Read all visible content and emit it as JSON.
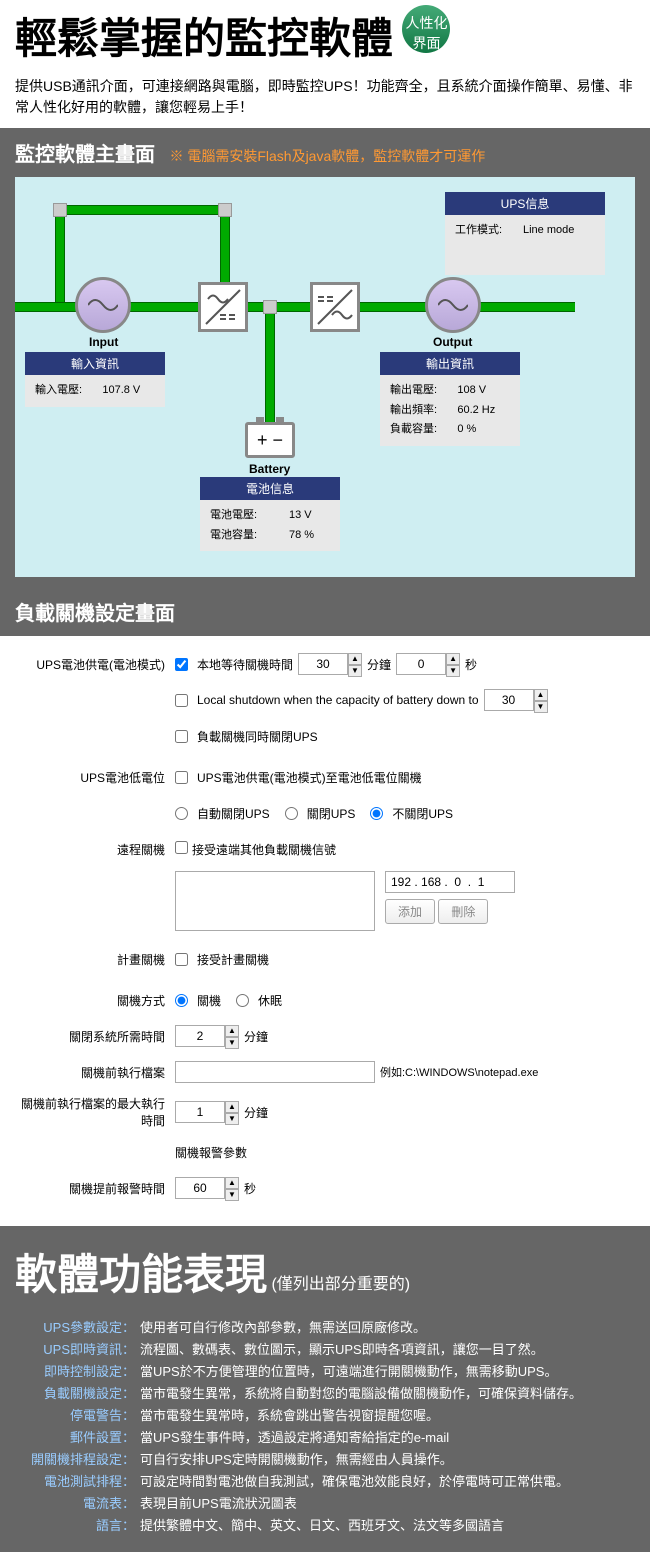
{
  "header": {
    "title": "輕鬆掌握的監控軟體",
    "badge": "人性化界面",
    "description": "提供USB通訊介面，可連接網路與電腦，即時監控UPS！功能齊全，且系統介面操作簡單、易懂、非常人性化好用的軟體，讓您輕易上手！"
  },
  "diagram": {
    "section_title": "監控軟體主畫面",
    "section_note": "※ 電腦需安裝Flash及java軟體，監控軟體才可運作",
    "ups_info": {
      "header": "UPS信息",
      "mode_label": "工作模式:",
      "mode_value": "Line mode"
    },
    "input": {
      "label": "Input",
      "header": "輸入資訊",
      "volt_label": "輸入電壓:",
      "volt_value": "107.8 V"
    },
    "output": {
      "label": "Output",
      "header": "輸出資訊",
      "volt_label": "輸出電壓:",
      "volt_value": "108 V",
      "freq_label": "輸出頻率:",
      "freq_value": "60.2 Hz",
      "load_label": "負載容量:",
      "load_value": "0 %"
    },
    "battery": {
      "label": "Battery",
      "header": "電池信息",
      "volt_label": "電池電壓:",
      "volt_value": "13 V",
      "cap_label": "電池容量:",
      "cap_value": "78 %"
    }
  },
  "settings": {
    "section_title": "負載關機設定畫面",
    "rows": {
      "battery_mode_label": "UPS電池供電(電池模式)",
      "local_wait": "本地等待關機時間",
      "minutes": "分鐘",
      "seconds": "秒",
      "wait_min": "30",
      "wait_sec": "0",
      "capacity_shutdown": "Local shutdown when the capacity of battery down to",
      "capacity_val": "30",
      "shutdown_ups_too": "負載關機同時關閉UPS",
      "low_batt_label": "UPS電池低電位",
      "low_batt_shutdown": "UPS電池供電(電池模式)至電池低電位關機",
      "auto_close": "自動關閉UPS",
      "close_ups": "關閉UPS",
      "no_close": "不關閉UPS",
      "remote_label": "遠程關機",
      "remote_accept": "接受遠端其他負載關機信號",
      "ip": "192 . 168 .  0  .  1",
      "add_btn": "添加",
      "del_btn": "刪除",
      "plan_label": "計畫關機",
      "plan_accept": "接受計畫關機",
      "shutdown_method_label": "關機方式",
      "method_shutdown": "關機",
      "method_hibernate": "休眠",
      "close_time_label": "關閉系統所需時間",
      "close_time_val": "2",
      "pre_file_label": "關機前執行檔案",
      "pre_file_hint": "例如:C:\\WINDOWS\\notepad.exe",
      "max_exec_label": "關機前執行檔案的最大執行時間",
      "max_exec_val": "1",
      "alarm_params": "關機報警參數",
      "alarm_time_label": "關機提前報警時間",
      "alarm_time_val": "60"
    }
  },
  "features": {
    "title": "軟體功能表現",
    "subtitle": "(僅列出部分重要的)",
    "items": [
      {
        "label": "UPS參數設定：",
        "text": "使用者可自行修改內部參數，無需送回原廠修改。"
      },
      {
        "label": "UPS即時資訊：",
        "text": "流程圖、數碼表、數位圖示，顯示UPS即時各項資訊，讓您一目了然。"
      },
      {
        "label": "即時控制設定：",
        "text": "當UPS於不方便管理的位置時，可遠端進行開關機動作，無需移動UPS。"
      },
      {
        "label": "負載關機設定：",
        "text": "當市電發生異常，系統將自動對您的電腦設備做關機動作，可確保資料儲存。"
      },
      {
        "label": "停電警告：",
        "text": "當市電發生異常時，系統會跳出警告視窗提醒您喔。"
      },
      {
        "label": "郵件設置：",
        "text": "當UPS發生事件時，透過設定將通知寄給指定的e-mail"
      },
      {
        "label": "開關機排程設定：",
        "text": "可自行安排UPS定時開關機動作，無需經由人員操作。"
      },
      {
        "label": "電池測試排程：",
        "text": "可設定時間對電池做自我測試，確保電池效能良好，於停電時可正常供電。"
      },
      {
        "label": "電流表：",
        "text": "表現目前UPS電流狀況圖表"
      },
      {
        "label": "語言：",
        "text": "提供繁體中文、簡中、英文、日文、西班牙文、法文等多國語言"
      }
    ]
  }
}
